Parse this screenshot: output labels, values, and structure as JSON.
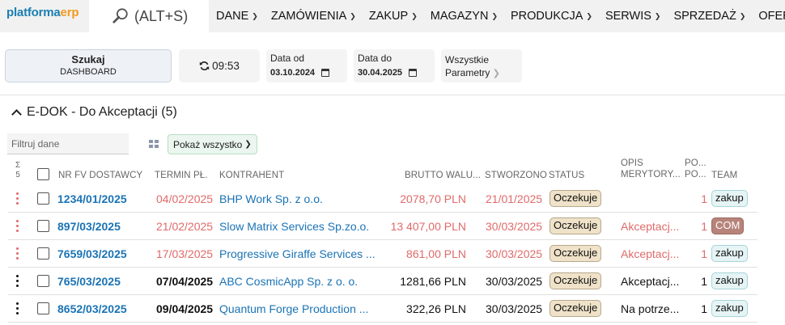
{
  "app": {
    "logo_part1": "platforma",
    "logo_part2": "erp"
  },
  "search": {
    "shortcut": "(ALT+S)"
  },
  "menu": [
    {
      "label": "DANE"
    },
    {
      "label": "ZAMÓWIENIA"
    },
    {
      "label": "ZAKUP"
    },
    {
      "label": "MAGAZYN"
    },
    {
      "label": "PRODUKCJA"
    },
    {
      "label": "SERWIS"
    },
    {
      "label": "SPRZEDAŻ"
    },
    {
      "label": "OFERTY"
    }
  ],
  "toolbar": {
    "search_button": {
      "line1": "Szukaj",
      "line2": "DASHBOARD"
    },
    "refresh_time": "09:53",
    "date_from": {
      "label": "Data od",
      "value": "03.10.2024"
    },
    "date_to": {
      "label": "Data do",
      "value": "30.04.2025"
    },
    "params": {
      "line1": "Wszystkie",
      "line2": "Parametry"
    }
  },
  "section": {
    "title": "E-DOK - Do Akceptacji (5)"
  },
  "filter": {
    "placeholder": "Filtruj dane"
  },
  "show_all": {
    "label": "Pokaż wszystko"
  },
  "table": {
    "sum": {
      "symbol": "Σ",
      "count": "5"
    },
    "headers": {
      "nr": "NR FV DOSTAWCY",
      "termin": "TERMIN PŁ.",
      "kontrahent": "KONTRAHENT",
      "brutto": "BRUTTO WALU...",
      "stworzono": "STWORZONO",
      "status": "STATUS",
      "opis_1": "OPIS",
      "opis_2": "MERYTORY...",
      "po_1": "PO...",
      "po_2": "PO...",
      "team": "TEAM"
    },
    "rows": [
      {
        "overdue": true,
        "nr": "1234/01/2025",
        "termin": "04/02/2025",
        "kontrahent": "BHP Work Sp. z o.o.",
        "brutto": "2078,70 PLN",
        "stworzono": "21/01/2025",
        "status": "Oczekuje",
        "opis": "",
        "po": "1",
        "team": "zakup"
      },
      {
        "overdue": true,
        "nr": "897/03/2025",
        "termin": "21/02/2025",
        "kontrahent": "Slow Matrix Services Sp.zo.o.",
        "brutto": "13 407,00 PLN",
        "stworzono": "30/03/2025",
        "status": "Oczekuje",
        "opis": "Akceptacj...",
        "po": "1",
        "team": "COM"
      },
      {
        "overdue": true,
        "nr": "7659/03/2025",
        "termin": "17/03/2025",
        "kontrahent": "Progressive Giraffe Services ...",
        "brutto": "861,00 PLN",
        "stworzono": "30/03/2025",
        "status": "Oczekuje",
        "opis": "Akceptacj...",
        "po": "1",
        "team": "zakup"
      },
      {
        "overdue": false,
        "nr": "765/03/2025",
        "termin": "07/04/2025",
        "kontrahent": "ABC CosmicApp Sp. z o. o.",
        "brutto": "1281,66 PLN",
        "stworzono": "30/03/2025",
        "status": "Oczekuje",
        "opis": "Akceptacj...",
        "po": "1",
        "team": "zakup"
      },
      {
        "overdue": false,
        "nr": "8652/03/2025",
        "termin": "09/04/2025",
        "kontrahent": "Quantum Forge Production ...",
        "brutto": "322,26 PLN",
        "stworzono": "30/03/2025",
        "status": "Oczekuje",
        "opis": "Na potrze...",
        "po": "1",
        "team": "zakup"
      }
    ]
  },
  "colors": {
    "accent": "#1a73b5",
    "overdue": "#e06a6a",
    "status_bg": "#efe2c9",
    "team_zakup_bg": "#e6f4f5",
    "team_com_bg": "#b7837a"
  }
}
